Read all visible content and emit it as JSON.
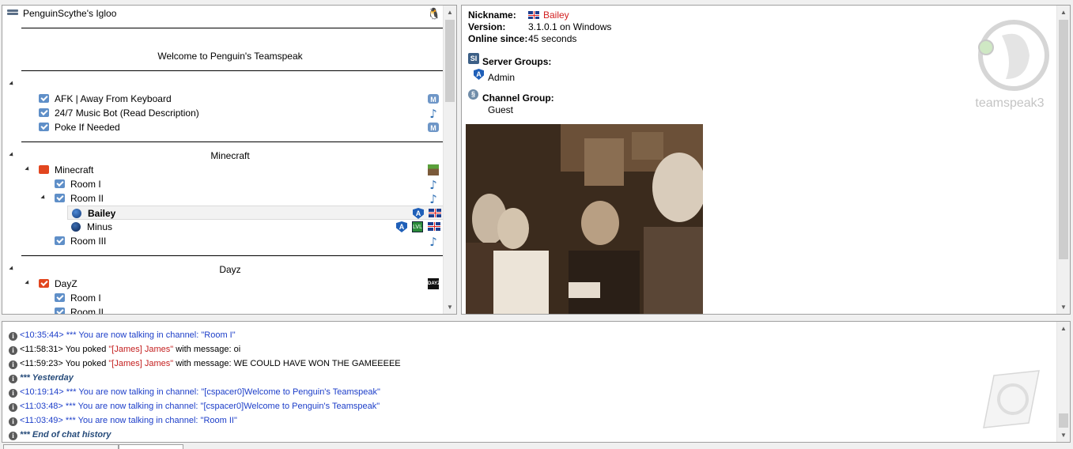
{
  "tree": {
    "server_name": "PenguinScythe's Igloo",
    "rows": [
      {
        "kind": "spacer-title",
        "text": "Welcome to Penguin's Teamspeak"
      },
      {
        "kind": "empty-spacer"
      },
      {
        "kind": "channel",
        "label": "AFK | Away From Keyboard",
        "icon": "m-badge"
      },
      {
        "kind": "channel",
        "label": "24/7 Music Bot (Read Description)",
        "icon": "music-note"
      },
      {
        "kind": "channel",
        "label": "Poke If Needed",
        "icon": "m-badge"
      },
      {
        "kind": "spacer-title",
        "text": "Minecraft"
      },
      {
        "kind": "channel",
        "label": "Minecraft",
        "icon": "grass-block"
      },
      {
        "kind": "subchannel",
        "label": "Room I",
        "icon": "music-note"
      },
      {
        "kind": "subchannel",
        "label": "Room II",
        "icon": "music-note"
      },
      {
        "kind": "client",
        "label": "Bailey",
        "selected": true
      },
      {
        "kind": "client",
        "label": "Minus"
      },
      {
        "kind": "subchannel",
        "label": "Room III",
        "icon": "music-note"
      },
      {
        "kind": "spacer-title",
        "text": "Dayz"
      },
      {
        "kind": "channel",
        "label": "DayZ",
        "icon": "dayz-logo"
      },
      {
        "kind": "subchannel",
        "label": "Room I"
      },
      {
        "kind": "subchannel",
        "label": "Room II"
      }
    ],
    "labels": {
      "welcome": "Welcome to Penguin's Teamspeak",
      "afk": "AFK | Away From Keyboard",
      "musicbot": "24/7 Music Bot (Read Description)",
      "poke": "Poke If Needed",
      "mc_spacer": "Minecraft",
      "mc_channel": "Minecraft",
      "room1": "Room I",
      "room2": "Room II",
      "bailey": "Bailey",
      "minus": "Minus",
      "room3": "Room III",
      "dayz_spacer": "Dayz",
      "dayz_channel": "DayZ",
      "dayz_room1": "Room I",
      "dayz_room2": "Room II",
      "m_badge": "M",
      "admin_badge": "A",
      "dayz_logo": "DAYZ",
      "group_badge": "LVL"
    }
  },
  "client_info": {
    "nickname_label": "Nickname:",
    "nickname": "Bailey",
    "version_label": "Version:",
    "version": "3.1.0.1 on Windows",
    "online_label": "Online since:",
    "online": "45 seconds",
    "server_groups_label": "Server Groups:",
    "server_group": "Admin",
    "channel_group_label": "Channel Group:",
    "channel_group": "Guest",
    "logo_text": "teamspeak3"
  },
  "chat": {
    "lines": [
      {
        "time": "<10:35:44>",
        "pre": "*** You are now talking in channel: ",
        "link": "\"Room I\"",
        "style": "blue"
      },
      {
        "time": "<11:58:31>",
        "pre": "You poked ",
        "link": "\"[James] James\"",
        "post": " with message: oi",
        "style": "poke"
      },
      {
        "time": "<11:59:23>",
        "pre": "You poked ",
        "link": "\"[James] James\"",
        "post": " with message: WE COULD HAVE WON THE GAMEEEEE",
        "style": "poke"
      },
      {
        "sep": "*** Yesterday"
      },
      {
        "time": "<10:19:14>",
        "pre": "*** You are now talking in channel: ",
        "link": "\"[cspacer0]Welcome to Penguin's Teamspeak\"",
        "style": "blue"
      },
      {
        "time": "<11:03:48>",
        "pre": "*** You are now talking in channel: ",
        "link": "\"[cspacer0]Welcome to Penguin's Teamspeak\"",
        "style": "blue"
      },
      {
        "time": "<11:03:49>",
        "pre": "*** You are now talking in channel: ",
        "link": "\"Room II\"",
        "style": "blue"
      },
      {
        "sep": "*** End of chat history"
      }
    ]
  },
  "colors": {
    "accent": "#1c3ec9",
    "nickname": "#d21f1f",
    "separator": "#264b7a"
  }
}
